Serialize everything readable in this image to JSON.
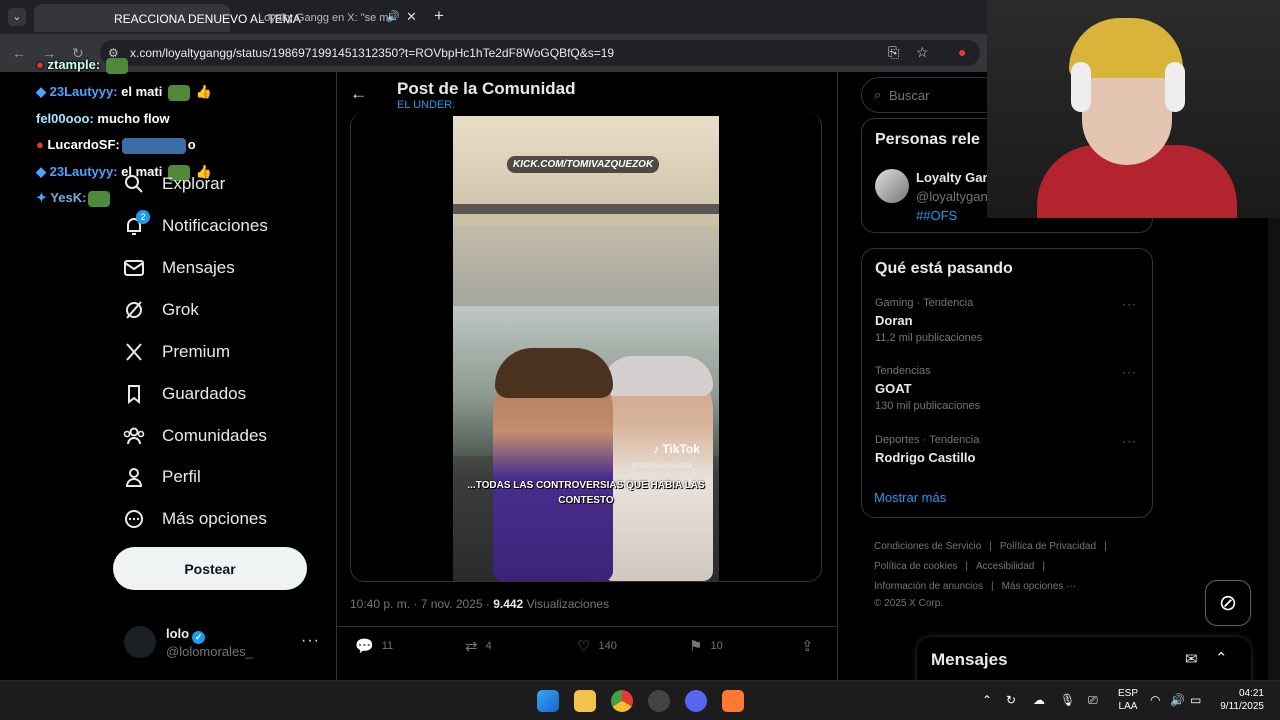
{
  "browser": {
    "tab1_title": "REACCIONA DENUEVO AL TEMA",
    "tab2_title": "Loyalty Gangg en X: \"se m",
    "url": "x.com/loyaltygangg/status/1986971991451312350?t=ROVbpHc1hTe2dF8WoGQBfQ&s=19"
  },
  "chat": [
    {
      "user": "ztample:",
      "msg": ""
    },
    {
      "user": "23Lautyyy:",
      "msg": "el mati"
    },
    {
      "user": "fel00ooo:",
      "msg": "mucho flow"
    },
    {
      "user": "LucardoSF:",
      "msg": "o"
    },
    {
      "user": "23Lautyyy:",
      "msg": "el mati"
    },
    {
      "user": "YesK:",
      "msg": ""
    }
  ],
  "nav": {
    "explore": "Explorar",
    "notifications": "Notificaciones",
    "notif_count": "2",
    "messages": "Mensajes",
    "grok": "Grok",
    "premium": "Premium",
    "bookmarks": "Guardados",
    "communities": "Comunidades",
    "profile": "Perfil",
    "more": "Más opciones",
    "post_button": "Postear"
  },
  "user": {
    "name": "lolo",
    "handle": "@lolomorales_"
  },
  "post": {
    "header_title": "Post de la Comunidad",
    "header_sub": "EL UNDER.",
    "video_banner": "KICK.COM/TOMIVAZQUEZOK",
    "video_watermark": "TikTok",
    "video_handle": "@tomivazquezok_",
    "video_caption": "...TODAS LAS CONTROVERSIAS QUE HABIA LAS CONTESTO",
    "timestamp": "10:40 p. m. · 7 nov. 2025 ·",
    "views": "9.442",
    "views_label": "Visualizaciones",
    "replies": "11",
    "reposts": "4",
    "likes": "140",
    "bookmarks": "10"
  },
  "right": {
    "search_placeholder": "Buscar",
    "relevant_title": "Personas rele",
    "relevant_name": "Loyalty Gang",
    "relevant_handle": "@loyaltygang",
    "relevant_bio": "##OFS",
    "trends_title": "Qué está pasando",
    "trends": [
      {
        "context": "Gaming · Tendencia",
        "topic": "Doran",
        "count": "11,2 mil publicaciones"
      },
      {
        "context": "Tendencias",
        "topic": "GOAT",
        "count": "130 mil publicaciones"
      },
      {
        "context": "Deportes · Tendencia",
        "topic": "Rodrigo Castillo",
        "count": ""
      }
    ],
    "show_more": "Mostrar más",
    "footer": {
      "terms": "Condiciones de Servicio",
      "privacy": "Política de Privacidad",
      "cookies": "Política de cookies",
      "accessibility": "Accesibilidad",
      "ads": "Información de anuncios",
      "more": "Más opciones ···",
      "copyright": "© 2025 X Corp."
    },
    "messages_dock": "Mensajes"
  },
  "taskbar": {
    "lang1": "ESP",
    "lang2": "LAA",
    "time": "04:21",
    "date": "9/11/2025"
  }
}
